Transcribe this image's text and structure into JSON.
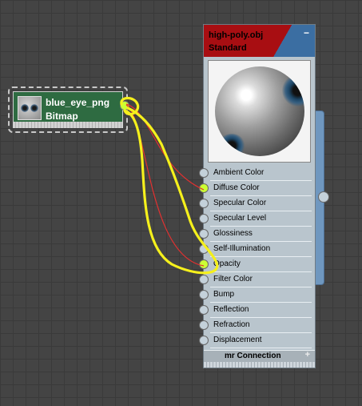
{
  "bitmap_node": {
    "name": "blue_eye_png",
    "type": "Bitmap"
  },
  "material_node": {
    "title": "high-poly.obj",
    "subtitle": "Standard",
    "collapse_symbol": "−",
    "header_colors": {
      "left": "#a80e12",
      "right": "#3b6ea2"
    },
    "slots": [
      {
        "label": "Ambient Color",
        "linked": false
      },
      {
        "label": "Diffuse Color",
        "linked": true
      },
      {
        "label": "Specular Color",
        "linked": false
      },
      {
        "label": "Specular Level",
        "linked": false
      },
      {
        "label": "Glossiness",
        "linked": false
      },
      {
        "label": "Self-Illumination",
        "linked": false
      },
      {
        "label": "Opacity",
        "linked": true
      },
      {
        "label": "Filter Color",
        "linked": false
      },
      {
        "label": "Bump",
        "linked": false
      },
      {
        "label": "Reflection",
        "linked": false
      },
      {
        "label": "Refraction",
        "linked": false
      },
      {
        "label": "Displacement",
        "linked": false
      }
    ],
    "mr_connection": {
      "label": "mr Connection",
      "expand_symbol": "+"
    }
  },
  "colors": {
    "wire": "#e33030",
    "highlight": "#f5f01c",
    "linked_socket": "#ccff33",
    "bitmap_node": "#2e6b41"
  }
}
